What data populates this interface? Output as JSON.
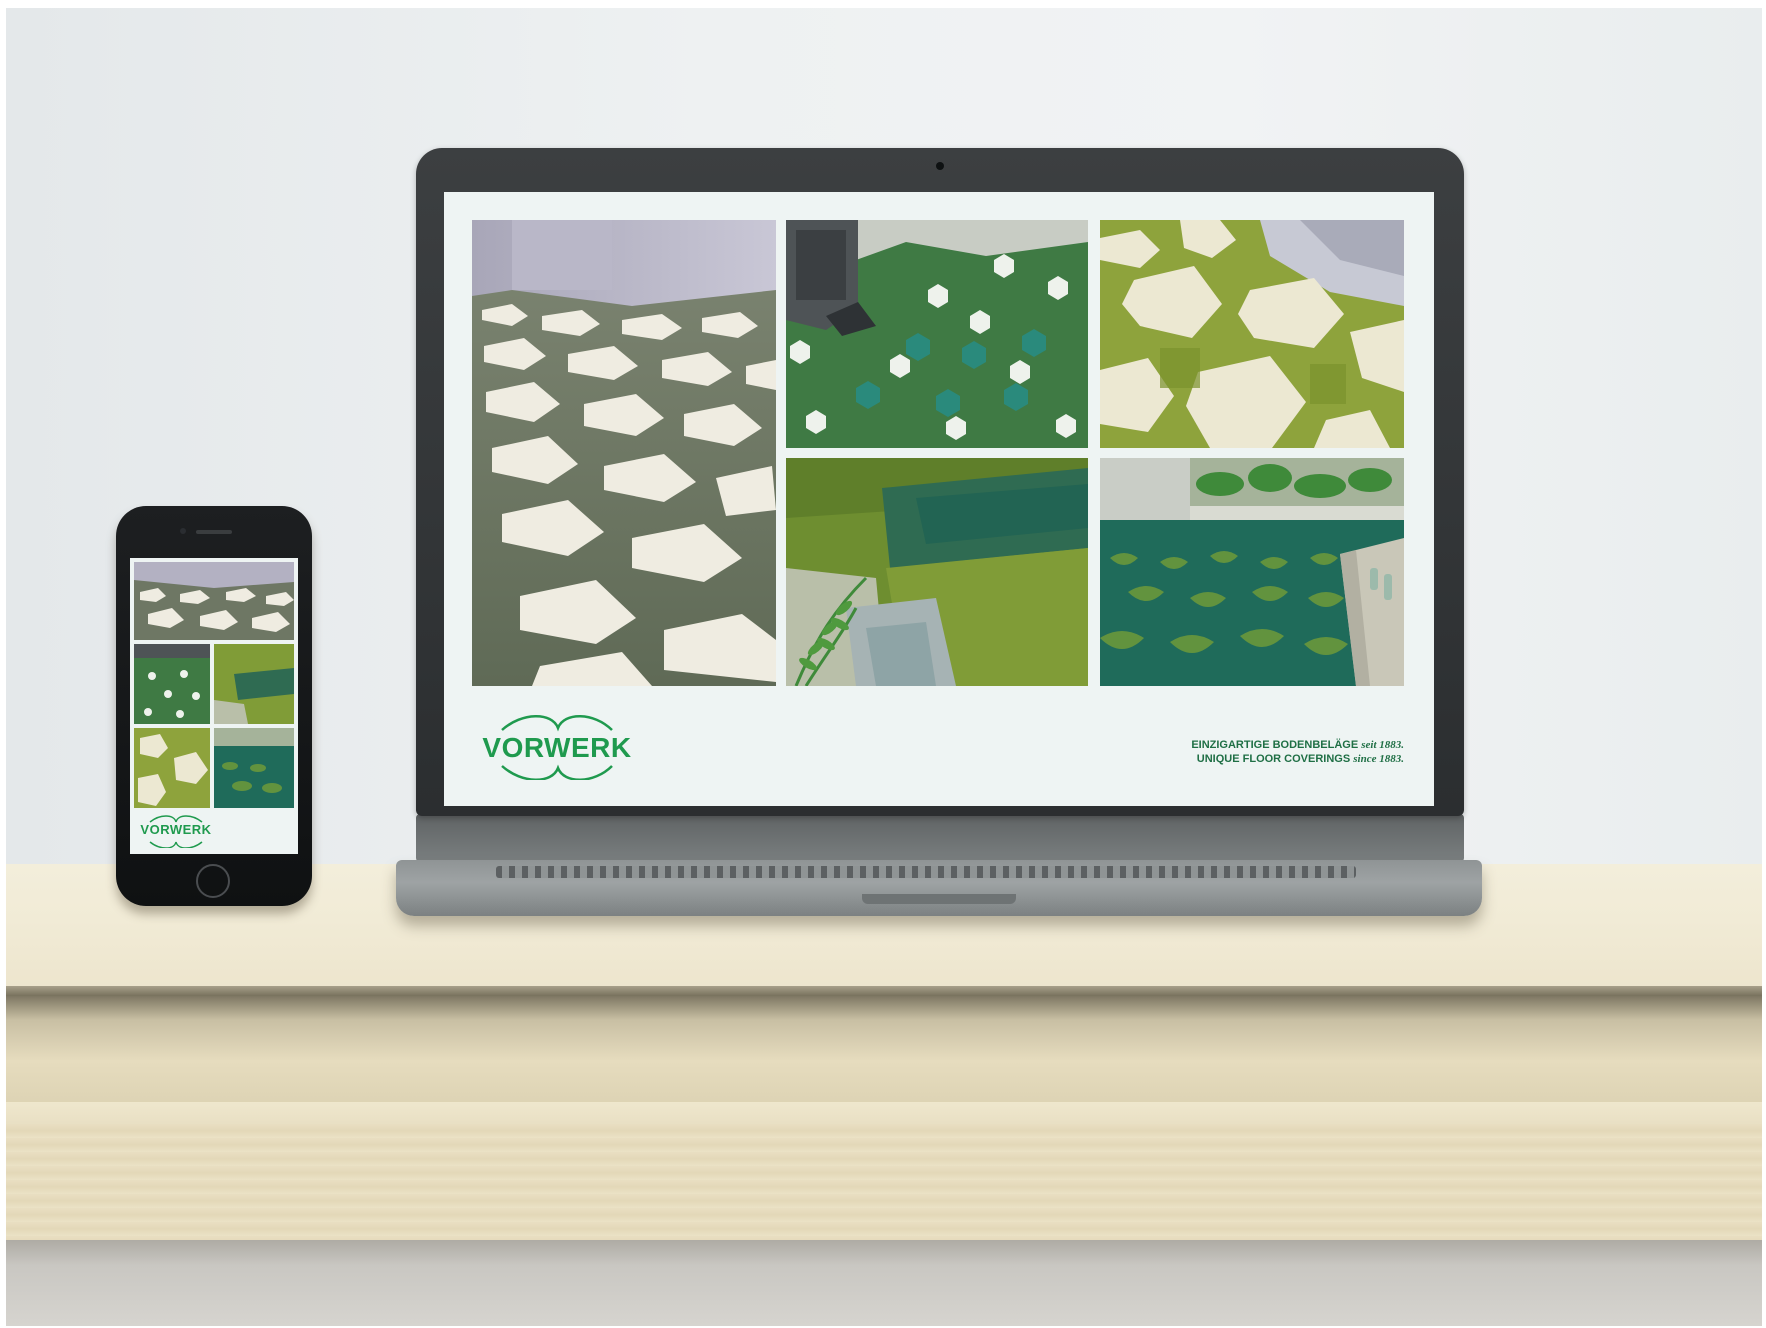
{
  "brand": {
    "logo_text": "VORWERK",
    "color": "#1f9a4e"
  },
  "tagline": {
    "line1_main": "EINZIGARTIGE BODENBELÄGE",
    "line1_italic": "seit 1883.",
    "line2_main": "UNIQUE FLOOR COVERINGS",
    "line2_italic": "since 1883."
  },
  "colors": {
    "accent_green": "#1f9a4e",
    "olive": "#7b9a2e",
    "teal": "#1e6b5c",
    "shelf_wood": "#efe7cf"
  }
}
